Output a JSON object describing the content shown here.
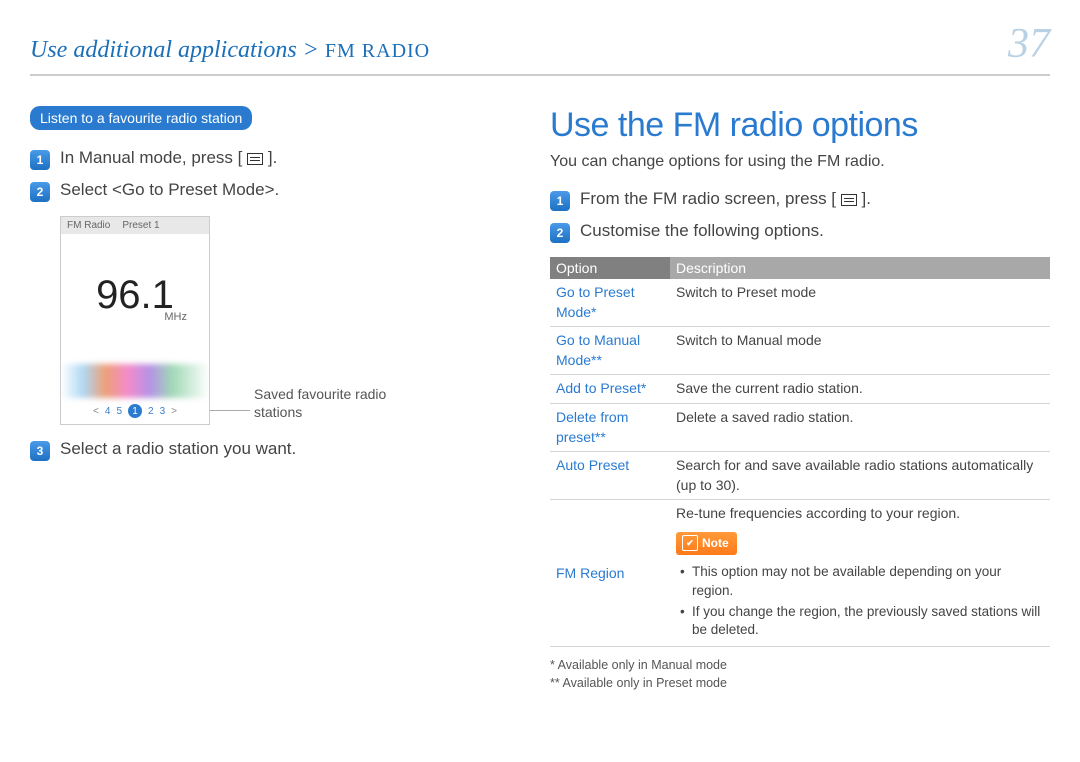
{
  "header": {
    "breadcrumb_main": "Use additional applications",
    "breadcrumb_sep": ">",
    "breadcrumb_sub": "FM RADIO",
    "page_number": "37"
  },
  "left": {
    "pill": "Listen to a favourite radio station",
    "steps": {
      "s1": "In Manual mode, press [",
      "s1b": "].",
      "s2": "Select <Go to Preset Mode>.",
      "s3": "Select a radio station you want."
    },
    "device": {
      "title": "FM Radio",
      "preset": "Preset 1",
      "frequency": "96.1",
      "unit": "MHz",
      "presets": {
        "p4": "4",
        "p5": "5",
        "p1": "1",
        "p2": "2",
        "p3": "3"
      }
    },
    "callout": "Saved favourite radio stations"
  },
  "right": {
    "title": "Use the FM radio options",
    "intro": "You can change options for using the FM radio.",
    "steps": {
      "s1": "From the FM radio screen, press [",
      "s1b": "].",
      "s2": "Customise the following options."
    },
    "table": {
      "th_option": "Option",
      "th_desc": "Description",
      "rows": [
        {
          "opt": "Go to Preset Mode*",
          "desc": "Switch to Preset mode"
        },
        {
          "opt": "Go to Manual Mode**",
          "desc": "Switch to Manual mode"
        },
        {
          "opt": "Add to Preset*",
          "desc": "Save the current radio station."
        },
        {
          "opt": "Delete from preset**",
          "desc": "Delete a saved radio station."
        },
        {
          "opt": "Auto Preset",
          "desc": "Search for and save available radio stations automatically (up to 30)."
        }
      ],
      "fm_region_opt": "FM Region",
      "fm_region_desc": "Re-tune frequencies according to your region.",
      "note_label": "Note",
      "note_items": [
        "This option may not be available depending on your region.",
        "If you change the region, the previously saved stations will be deleted."
      ]
    },
    "footnotes": {
      "f1": "* Available only in Manual mode",
      "f2": "** Available only in Preset mode"
    }
  }
}
